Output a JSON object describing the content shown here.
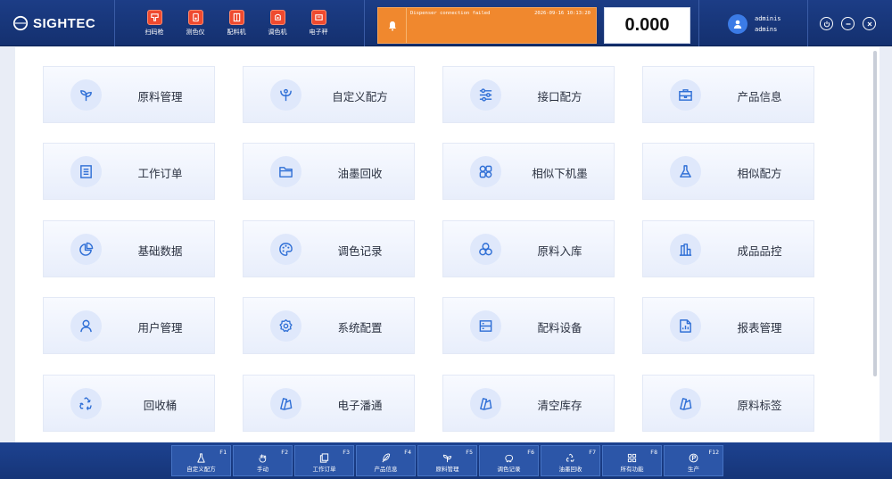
{
  "header": {
    "logo_text": "SIGHTEC",
    "devices": [
      {
        "label": "扫码枪",
        "icon": "barcode-scanner-icon"
      },
      {
        "label": "测色仪",
        "icon": "spectrophotometer-icon"
      },
      {
        "label": "配料机",
        "icon": "dispenser-icon"
      },
      {
        "label": "调色机",
        "icon": "mixer-icon"
      },
      {
        "label": "电子秤",
        "icon": "scale-icon"
      }
    ],
    "alert": {
      "message": "Dispenser connection failed",
      "time": "2026-09-16 10:13:20",
      "icon": "bell-icon"
    },
    "scale_reading": "0.000",
    "user": {
      "name": "adminis",
      "role": "admins",
      "icon": "user-avatar-icon"
    },
    "window_controls": [
      "power-icon",
      "minimize-icon",
      "close-icon"
    ]
  },
  "colors": {
    "header_bg": "#1c3d86",
    "device_icon_bg": "#ef4a2f",
    "alert_bg": "#f0882e",
    "accent": "#2f6fd6",
    "footer_bg": "#1d4290",
    "fkey_bg": "#2c56a8"
  },
  "tiles": [
    {
      "label": "原料管理",
      "icon": "sprout-icon"
    },
    {
      "label": "自定义配方",
      "icon": "custom-formula-icon"
    },
    {
      "label": "接口配方",
      "icon": "sliders-icon"
    },
    {
      "label": "产品信息",
      "icon": "briefcase-icon"
    },
    {
      "label": "工作订单",
      "icon": "document-list-icon"
    },
    {
      "label": "油墨回收",
      "icon": "folder-icon"
    },
    {
      "label": "相似下机墨",
      "icon": "apps-icon"
    },
    {
      "label": "相似配方",
      "icon": "flask-icon"
    },
    {
      "label": "基础数据",
      "icon": "pie-chart-icon"
    },
    {
      "label": "调色记录",
      "icon": "palette-icon"
    },
    {
      "label": "原料入库",
      "icon": "circles-icon"
    },
    {
      "label": "成品品控",
      "icon": "bar-chart-icon"
    },
    {
      "label": "用户管理",
      "icon": "user-icon"
    },
    {
      "label": "系统配置",
      "icon": "gear-icon"
    },
    {
      "label": "配料设备",
      "icon": "device-icon"
    },
    {
      "label": "报表管理",
      "icon": "report-icon"
    },
    {
      "label": "回收桶",
      "icon": "recycle-icon"
    },
    {
      "label": "电子潘通",
      "icon": "swatch-icon"
    },
    {
      "label": "清空库存",
      "icon": "swatch-icon"
    },
    {
      "label": "原料标签",
      "icon": "swatch-icon"
    }
  ],
  "function_keys": [
    {
      "key": "F1",
      "label": "自定义配方",
      "icon": "flask-icon"
    },
    {
      "key": "F2",
      "label": "手动",
      "icon": "hand-icon"
    },
    {
      "key": "F3",
      "label": "工作订单",
      "icon": "copy-icon"
    },
    {
      "key": "F4",
      "label": "产品信息",
      "icon": "feather-icon"
    },
    {
      "key": "F5",
      "label": "原料管理",
      "icon": "sprout-icon"
    },
    {
      "key": "F6",
      "label": "调色记录",
      "icon": "piggy-bank-icon"
    },
    {
      "key": "F7",
      "label": "油墨回收",
      "icon": "recycle-icon"
    },
    {
      "key": "F8",
      "label": "所有功能",
      "icon": "grid-icon"
    },
    {
      "key": "F12",
      "label": "生产",
      "icon": "production-icon"
    }
  ]
}
